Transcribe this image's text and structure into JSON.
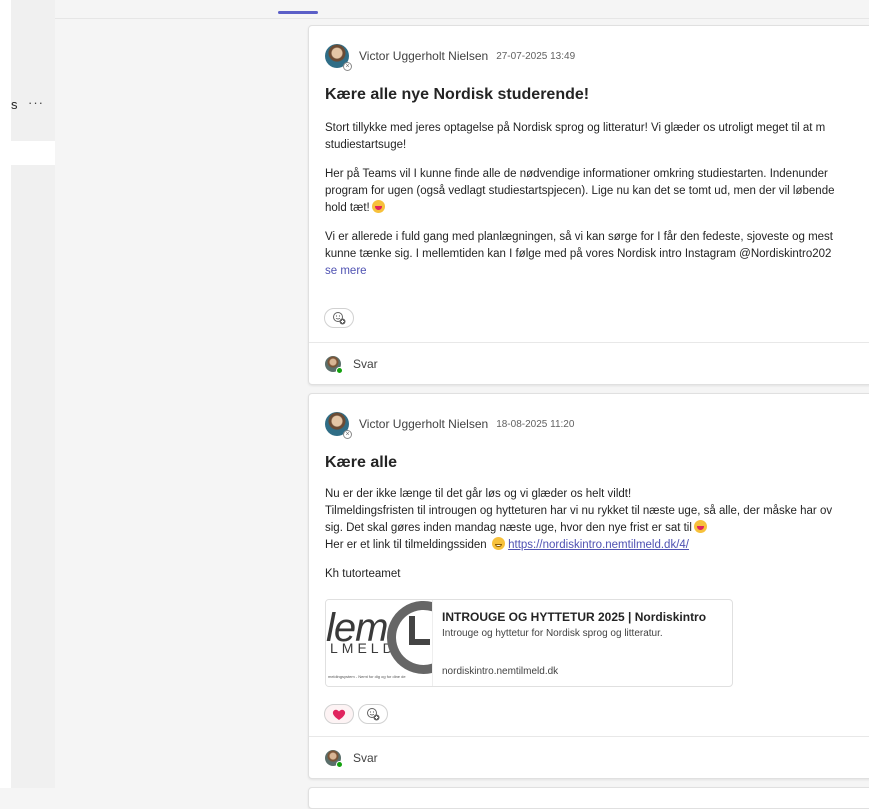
{
  "sidebar": {
    "truncated_label": "s",
    "more_label": "···"
  },
  "posts": [
    {
      "author": "Victor Uggerholt Nielsen",
      "timestamp": "27-07-2025 13:49",
      "title": "Kære alle nye Nordisk studerende!",
      "paragraphs": [
        [
          "Stort tillykke med jeres optagelse på Nordisk sprog og litteratur! Vi glæder os utroligt meget til at m",
          "studiestartsuge!"
        ],
        [
          "Her på Teams vil I kunne finde alle de nødvendige informationer omkring studiestarten. Indenunder",
          "program for ugen (også vedlagt studiestartspjecen). Lige nu kan det se tomt ud, men der vil løbende",
          "hold tæt!"
        ],
        [
          "Vi er allerede i fuld gang med planlægningen, så vi kan sørge for I får den fedeste, sjoveste og mest",
          "kunne tænke sig. I mellemtiden kan I følge med på vores Nordisk intro Instagram @Nordiskintro202"
        ]
      ],
      "see_more": "se mere",
      "reply_label": "Svar",
      "icons": {
        "presence": "presence-unknown-icon",
        "add_reaction": "add-reaction-icon"
      }
    },
    {
      "author": "Victor Uggerholt Nielsen",
      "timestamp": "18-08-2025 11:20",
      "title": "Kære alle",
      "lines": [
        "Nu er der ikke længe til det går løs og vi glæder os helt vildt!",
        "Tilmeldingsfristen til introugen og hytteturen har vi nu rykket til næste uge, så alle, der måske har ov",
        "sig. Det skal gøres inden mandag næste uge, hvor den nye frist er sat til"
      ],
      "link_prefix": "Her er et link til tilmeldingssiden",
      "link_url": "https://nordiskintro.nemtilmeld.dk/4/",
      "signoff": "Kh tutorteamet",
      "link_preview": {
        "logo_text": "lem",
        "logo_sub": "LMELD",
        "logo_tagline": "meldingsystem - Nemt for dig og for dine de",
        "title": "INTROUGE OG HYTTETUR 2025 | Nordiskintro",
        "description": "Introuge og hyttetur for Nordisk sprog og litteratur.",
        "domain": "nordiskintro.nemtilmeld.dk"
      },
      "reply_label": "Svar",
      "icons": {
        "reaction": "heart-icon",
        "add_reaction": "add-reaction-icon"
      }
    }
  ],
  "colors": {
    "accent": "#5b5fc7",
    "link": "#4f52b2",
    "heart": "#e0245e",
    "online": "#13a10e"
  }
}
